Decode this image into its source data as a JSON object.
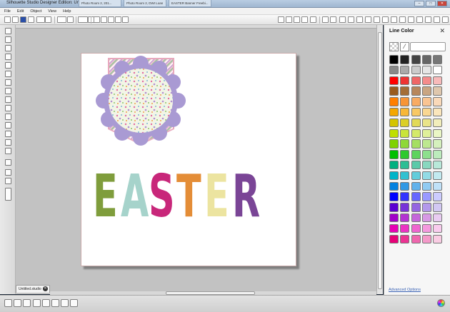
{
  "window": {
    "title": "Silhouette Studio Designer Edition: Untitled.studio",
    "taskbar_tabs": [
      "Photo Room 2, 201...",
      "Photo Room 2, DWI Loan",
      "EASTER Banner Freebi..."
    ]
  },
  "menu": [
    "File",
    "Edit",
    "Object",
    "View",
    "Help"
  ],
  "document": {
    "tab_label": "Untitled.studio",
    "easter_letters": [
      {
        "char": "E",
        "color": "#7f9d3c"
      },
      {
        "char": "A",
        "color": "#a6d3cb"
      },
      {
        "char": "S",
        "color": "#c8277a"
      },
      {
        "char": "T",
        "color": "#e48d37"
      },
      {
        "char": "E",
        "color": "#ece4a0"
      },
      {
        "char": "R",
        "color": "#7a4596"
      }
    ],
    "banner_colors": {
      "pink": "#f3c4d3",
      "purple": "#a99ad3",
      "inner": "#f2f5e6"
    }
  },
  "panel": {
    "title": "Line Color",
    "close_glyph": "✕",
    "advanced_label": "Advanced Options",
    "swatches": [
      "#000000",
      "#222222",
      "#444444",
      "#666666",
      "#777777",
      "#888888",
      "#aaaaaa",
      "#cccccc",
      "#e6e6e6",
      "#ffffff",
      "#ff0000",
      "#ee3333",
      "#f06666",
      "#f48b8b",
      "#f8baba",
      "#995b1e",
      "#a46d36",
      "#b8875c",
      "#c9a582",
      "#dfc7ad",
      "#ff7f00",
      "#f79436",
      "#f8ab63",
      "#f9c492",
      "#fad9b9",
      "#f4a700",
      "#f7b737",
      "#f8c865",
      "#f9d792",
      "#fbe6bc",
      "#d4c400",
      "#dbcf26",
      "#e2da56",
      "#eae489",
      "#f2eebb",
      "#bfdf00",
      "#c9e43a",
      "#d4ea6a",
      "#dff09a",
      "#eaf6c5",
      "#7fd200",
      "#8ed838",
      "#a5df62",
      "#bde88f",
      "#d5f0bd",
      "#00bf00",
      "#2ec92e",
      "#5ed45e",
      "#8de08d",
      "#bcebbc",
      "#00b07f",
      "#2dbe94",
      "#5acaa9",
      "#88d8bf",
      "#b8e8d9",
      "#00b4c8",
      "#32c1d1",
      "#63cddb",
      "#92dbe5",
      "#c2eaf0",
      "#0080e0",
      "#3199e5",
      "#61b2ec",
      "#91cbf2",
      "#c0e1f8",
      "#0000ff",
      "#3333ff",
      "#6666ff",
      "#9999ff",
      "#ccccff",
      "#5a00d2",
      "#7733d9",
      "#9566e2",
      "#b399eb",
      "#d2c8f3",
      "#a000c8",
      "#b333d2",
      "#c566db",
      "#d799e5",
      "#e9ccf2",
      "#e600b4",
      "#eb33c3",
      "#ef66d0",
      "#f499de",
      "#f9ccee",
      "#e60078",
      "#eb3393",
      "#ef66ae",
      "#f499c9",
      "#f9cce3"
    ]
  }
}
